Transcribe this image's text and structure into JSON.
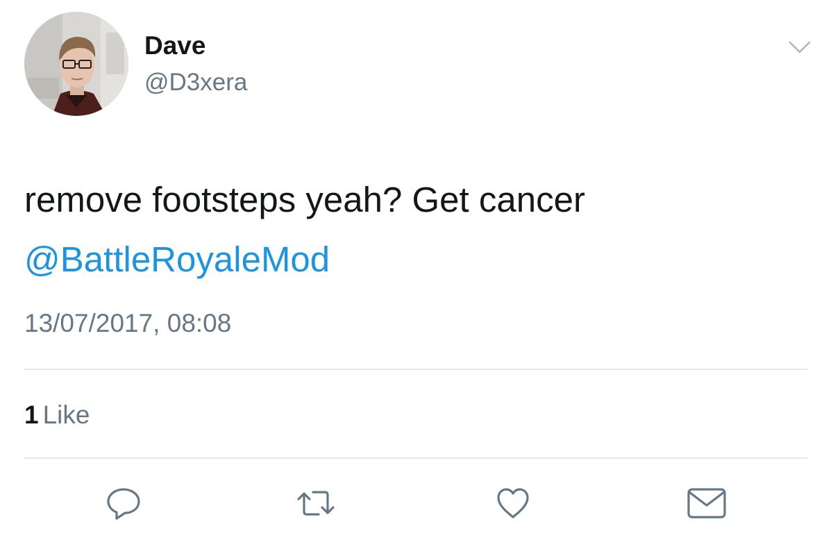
{
  "author": {
    "name": "Dave",
    "handle": "@D3xera"
  },
  "tweet": {
    "text": "remove footsteps yeah? Get cancer",
    "mention": "@BattleRoyaleMod",
    "timestamp": "13/07/2017, 08:08"
  },
  "stats": {
    "likes_count": "1",
    "likes_label": "Like"
  },
  "actions": [
    {
      "name": "reply",
      "icon": "reply-icon"
    },
    {
      "name": "retweet",
      "icon": "retweet-icon"
    },
    {
      "name": "like",
      "icon": "heart-icon"
    },
    {
      "name": "direct-message",
      "icon": "envelope-icon"
    }
  ],
  "colors": {
    "text": "#14171a",
    "secondary": "#657786",
    "link": "#1b95e0",
    "divider": "#e1e8ed"
  }
}
